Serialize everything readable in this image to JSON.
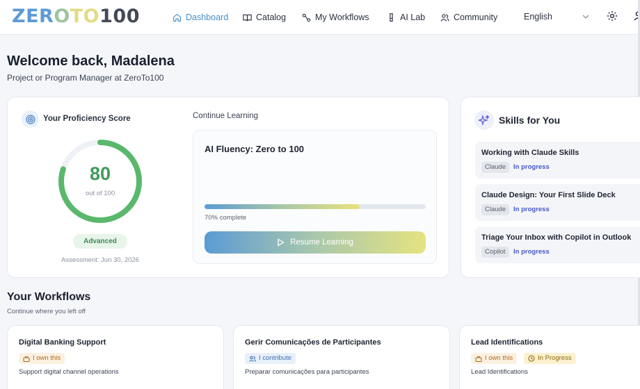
{
  "nav": {
    "logo": {
      "part1": "ZER",
      "part2": "O",
      "part3": "TO",
      "part4": "100"
    },
    "items": [
      {
        "label": "Dashboard",
        "icon": "home-icon",
        "active": true
      },
      {
        "label": "Catalog",
        "icon": "book-icon"
      },
      {
        "label": "My Workflows",
        "icon": "workflow-icon"
      },
      {
        "label": "AI Lab",
        "icon": "flask-icon"
      },
      {
        "label": "Community",
        "icon": "users-icon"
      }
    ],
    "language": "English"
  },
  "header": {
    "welcome": "Welcome back, Madalena",
    "role": "Project or Program Manager at ZeroTo100"
  },
  "proficiency": {
    "title": "Your Proficiency Score",
    "score": "80",
    "score_value": 80,
    "score_max": 100,
    "score_sub": "out of 100",
    "level": "Advanced",
    "assessment": "Assessment: Jun 30, 2026"
  },
  "continue_learning": {
    "title": "Continue Learning",
    "course": "AI Fluency: Zero to 100",
    "progress": 70,
    "progress_text": "70% complete",
    "button": "Resume Learning"
  },
  "skills": {
    "title": "Skills for You",
    "items": [
      {
        "title": "Working with Claude Skills",
        "tag": "Claude",
        "status": "In progress"
      },
      {
        "title": "Claude Design: Your First Slide Deck",
        "tag": "Claude",
        "status": "In progress"
      },
      {
        "title": "Triage Your Inbox with Copilot in Outlook",
        "tag": "Copilot",
        "status": "In progress"
      }
    ]
  },
  "workflows": {
    "title": "Your Workflows",
    "subtitle": "Continue where you left off",
    "items": [
      {
        "name": "Digital Banking Support",
        "badge": "I own this",
        "description": "Support digital channel operations"
      },
      {
        "name": "Gerir Comunicações de Participantes",
        "badge": "I contribute",
        "description": "Preparar comunicações para participantes"
      },
      {
        "name": "Lead Identifications",
        "badge": "I own this",
        "badge2": "In Progress",
        "description": "Lead Identifications"
      }
    ]
  },
  "colors": {
    "accent": "#5b9bd5",
    "score_green": "#3f9a5b",
    "status_purple": "#4857c7"
  }
}
